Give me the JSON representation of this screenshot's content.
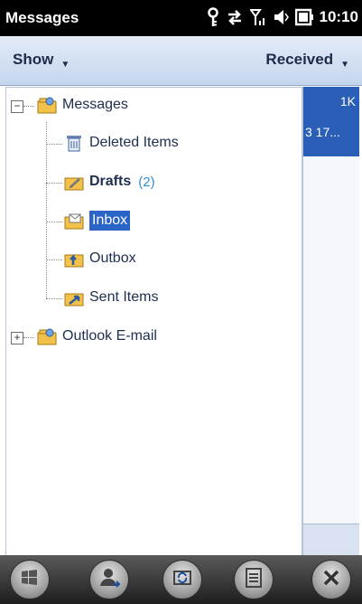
{
  "status": {
    "app_title": "Messages",
    "time": "10:10"
  },
  "menu": {
    "left_label": "Show",
    "right_label": "Received"
  },
  "tree": {
    "root": {
      "label": "Messages"
    },
    "children": [
      {
        "label": "Deleted Items"
      },
      {
        "label": "Drafts",
        "count": "(2)"
      },
      {
        "label": "Inbox"
      },
      {
        "label": "Outbox"
      },
      {
        "label": "Sent Items"
      }
    ],
    "second_root": {
      "label": "Outlook E-mail"
    }
  },
  "message_list": {
    "selected_size": "1K",
    "selected_date": "3 17..."
  },
  "colors": {
    "selection": "#2a64c6",
    "count": "#2f8dd8",
    "menubar": "#c6d6ee"
  }
}
